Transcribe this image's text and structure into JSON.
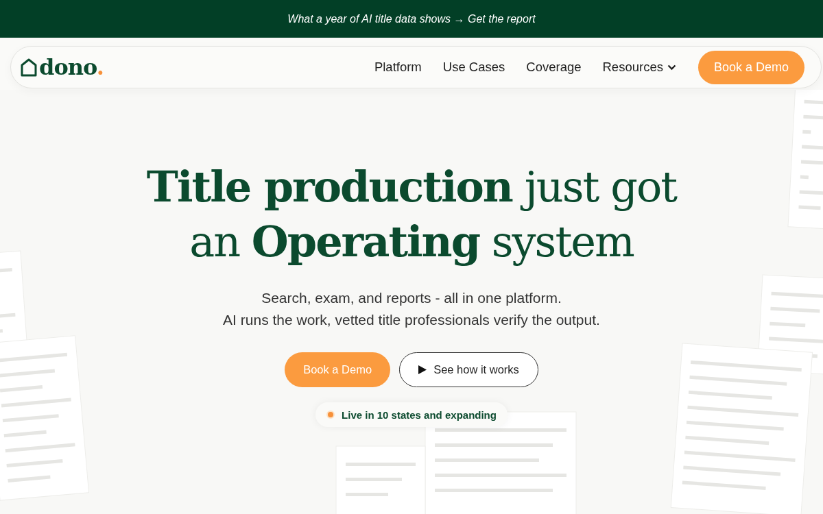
{
  "announcement": "What a year of AI title data shows → Get the report",
  "nav": {
    "logo": "dono",
    "logo_dot": ".",
    "links": [
      {
        "label": "Platform",
        "dropdown": false
      },
      {
        "label": "Use Cases",
        "dropdown": false
      },
      {
        "label": "Coverage",
        "dropdown": false
      },
      {
        "label": "Resources",
        "dropdown": true
      }
    ],
    "cta": "Book a Demo"
  },
  "hero": {
    "headline": "**Title production** just got an **Operating** system",
    "subtitle_lines": [
      "Search, exam, and reports - all in one platform.",
      "AI runs the work, vetted title professionals verify the output."
    ],
    "buttons": [
      {
        "kind": "primary",
        "label": "Book a Demo"
      },
      {
        "kind": "video",
        "label": "See how it works"
      }
    ],
    "badge": "Live in 10 states and expanding"
  }
}
